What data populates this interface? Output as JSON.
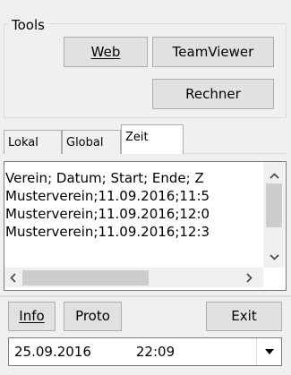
{
  "tools": {
    "label": "Tools",
    "web_button": "Web",
    "teamviewer_button": "TeamViewer",
    "rechner_button": "Rechner"
  },
  "tabs": [
    {
      "label": "Lokal"
    },
    {
      "label": "Global"
    },
    {
      "label": "Zeit"
    }
  ],
  "list": {
    "lines": [
      "Verein; Datum; Start; Ende; Z",
      "Musterverein;11.09.2016;11:5",
      "Musterverein;11.09.2016;12:0",
      "Musterverein;11.09.2016;12:3"
    ]
  },
  "icons": {
    "scroll_up": "chevron-up-icon",
    "scroll_down": "chevron-down-icon",
    "scroll_left": "chevron-left-icon",
    "scroll_right": "chevron-right-icon",
    "combo_dropdown": "triangle-down-icon"
  },
  "bottom": {
    "info_button": "Info",
    "proto_button": "Proto",
    "exit_button": "Exit"
  },
  "combo": {
    "date": "25.09.2016",
    "time": "22:09"
  }
}
